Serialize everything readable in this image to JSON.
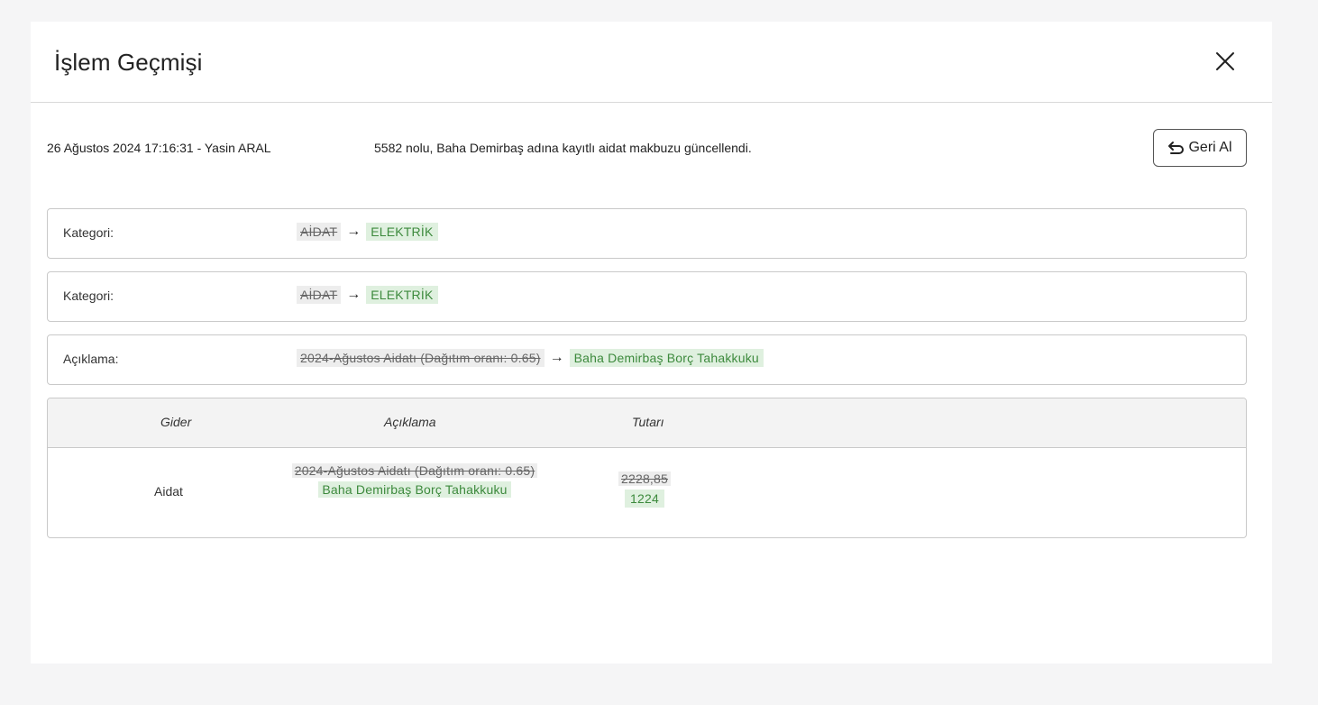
{
  "modal": {
    "title": "İşlem Geçmişi"
  },
  "log": {
    "timestamp_user": "26 Ağustos 2024 17:16:31 - Yasin ARAL",
    "description": "5582 nolu, Baha Demirbaş adına kayıtlı aidat makbuzu güncellendi.",
    "undo_label": "Geri Al"
  },
  "changes": [
    {
      "label": "Kategori:",
      "old": "AİDAT",
      "arrow": "→",
      "new": "ELEKTRİK"
    },
    {
      "label": "Kategori:",
      "old": "AİDAT",
      "arrow": "→",
      "new": "ELEKTRİK"
    },
    {
      "label": "Açıklama:",
      "old": "2024-Ağustos Aidatı (Dağıtım oranı: 0.65)",
      "arrow": "→",
      "new": "Baha Demirbaş Borç Tahakkuku"
    }
  ],
  "table": {
    "headers": {
      "gider": "Gider",
      "aciklama": "Açıklama",
      "tutar": "Tutarı"
    },
    "rows": [
      {
        "gider": "Aidat",
        "aciklama_old": "2024-Ağustos Aidatı (Dağıtım oranı: 0.65)",
        "aciklama_new": "Baha Demirbaş Borç Tahakkuku",
        "tutar_old": "2228,85",
        "tutar_new": "1224"
      }
    ]
  },
  "icons": {
    "close": "close-icon",
    "undo": "undo-arrow-icon"
  }
}
